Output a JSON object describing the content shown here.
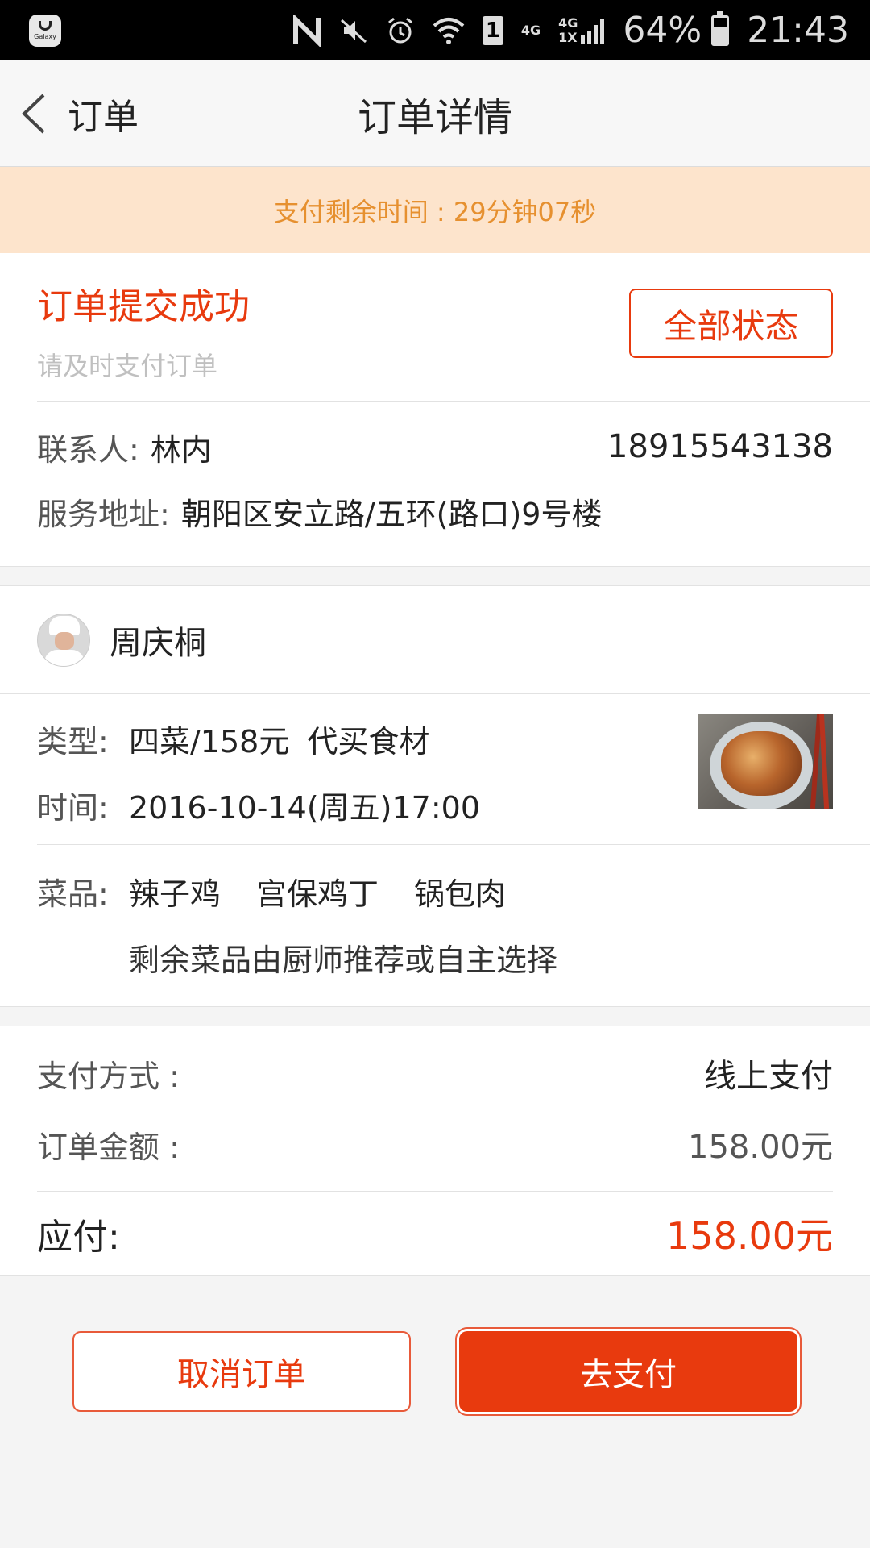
{
  "statusbar": {
    "battery": "64%",
    "battery_level": 0.64,
    "time": "21:43",
    "galaxy_label": "Galaxy",
    "sim_label": "1",
    "net_label_top": "4G",
    "net_label_mid": "4G",
    "net_label_bottom": "1X"
  },
  "nav": {
    "back_label": "订单",
    "title": "订单详情"
  },
  "notice": {
    "text": "支付剩余时间 : 29分钟07秒"
  },
  "status": {
    "title": "订单提交成功",
    "subtitle": "请及时支付订单",
    "all_status_button": "全部状态"
  },
  "contact": {
    "name_label": "联系人:",
    "name": "林内",
    "phone": "18915543138",
    "address_label": "服务地址:",
    "address": "朝阳区安立路/五环(路口)9号楼"
  },
  "chef": {
    "name": "周庆桐"
  },
  "service": {
    "type_label": "类型:",
    "type_value": "四菜/158元",
    "type_extra": "代买食材",
    "time_label": "时间:",
    "time_value": "2016-10-14(周五)17:00"
  },
  "dishes": {
    "label": "菜品:",
    "items": [
      "辣子鸡",
      "宫保鸡丁",
      "锅包肉"
    ],
    "note": "剩余菜品由厨师推荐或自主选择"
  },
  "payment": {
    "method_label": "支付方式 :",
    "method_value": "线上支付",
    "amount_label": "订单金额 :",
    "amount_value": "158.00元",
    "due_label": "应付:",
    "due_value": "158.00元"
  },
  "actions": {
    "cancel_label": "取消订单",
    "pay_label": "去支付"
  }
}
